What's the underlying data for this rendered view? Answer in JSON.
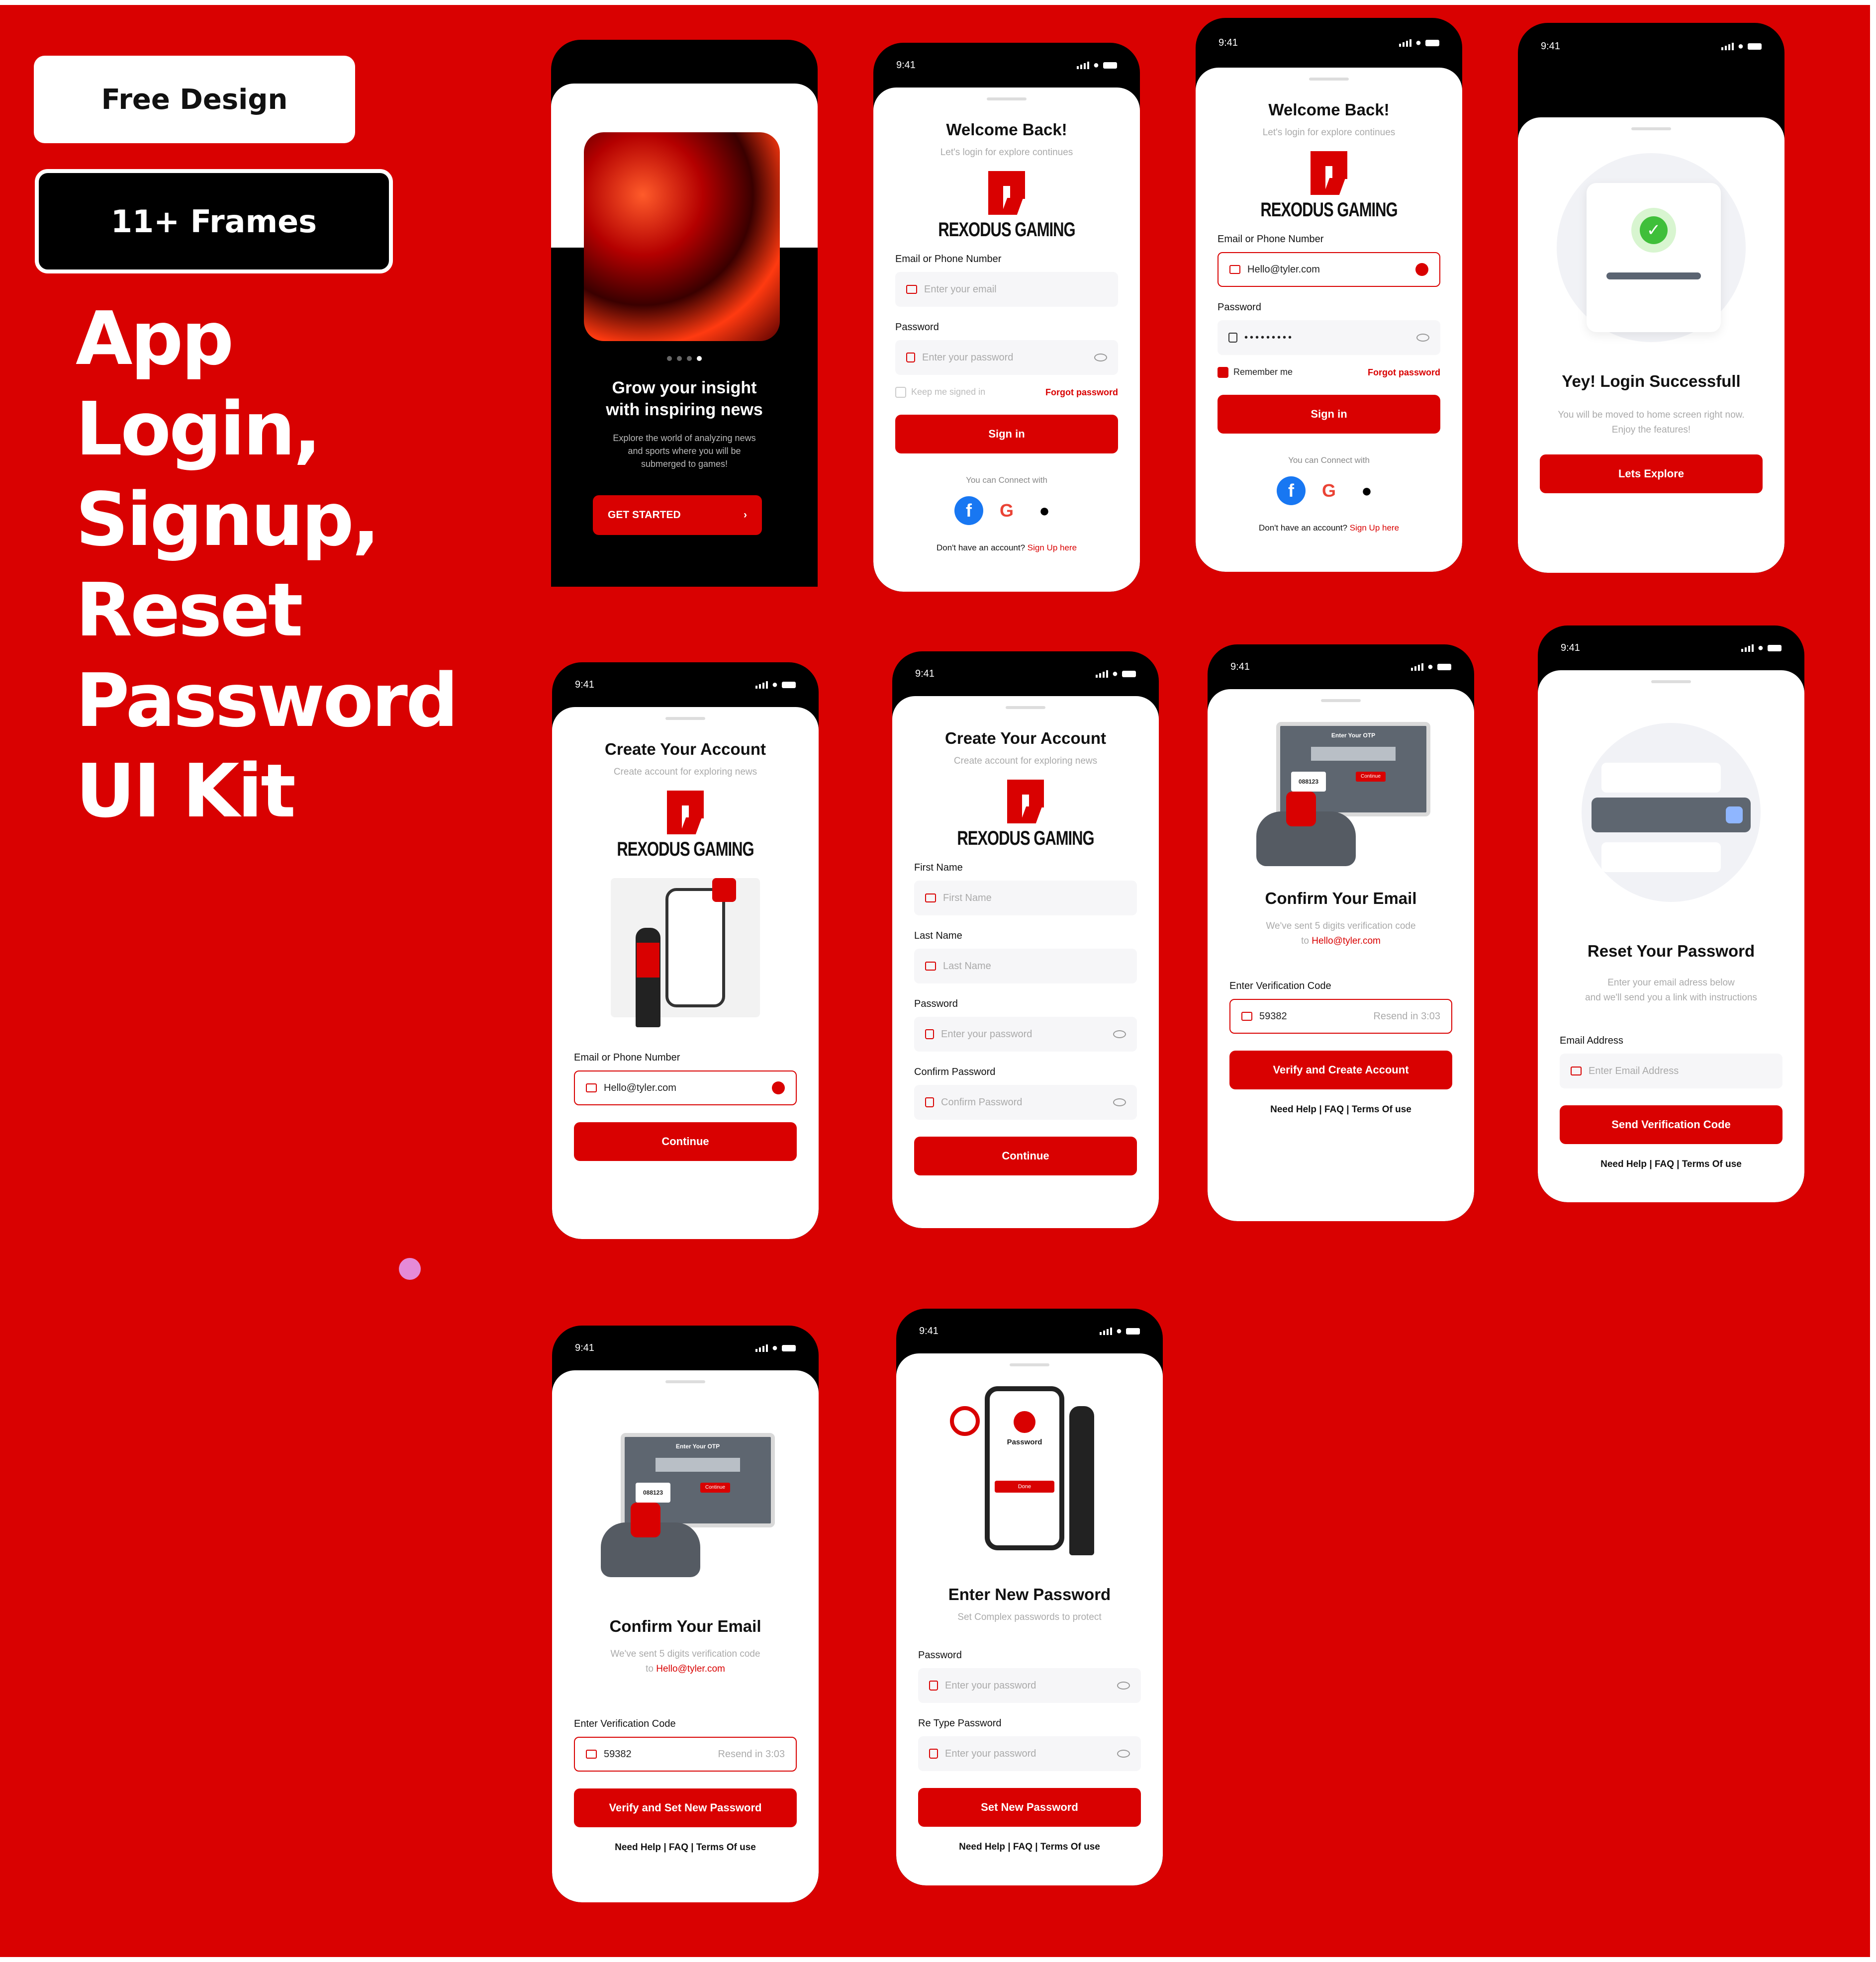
{
  "badges": {
    "free": "Free Design",
    "frames": "11+ Frames"
  },
  "hero": {
    "lines": [
      "App",
      "Login,",
      "Signup,",
      "Reset",
      "Password",
      "UI Kit"
    ]
  },
  "status": {
    "time": "9:41"
  },
  "brand": {
    "name": "REXODUS GAMING"
  },
  "colors": {
    "accent": "#d90101",
    "dark": "#000000",
    "pink": "#e58ad7"
  },
  "onboarding": {
    "title_line1": "Grow your insight",
    "title_line2": "with inspiring news",
    "desc_line1": "Explore the world of analyzing news",
    "desc_line2": "and sports where you will be",
    "desc_line3": "submerged to games!",
    "cta": "GET STARTED"
  },
  "login": {
    "title": "Welcome Back!",
    "subtitle": "Let's login for explore continues",
    "email_label": "Email or Phone Number",
    "email_placeholder": "Enter your email",
    "password_label": "Password",
    "password_placeholder": "Enter your password",
    "keep": "Keep me signed in",
    "forgot": "Forgot password",
    "signin": "Sign in",
    "connect": "You can Connect with",
    "no_account": "Don't have an account?",
    "signup_link": "Sign Up here"
  },
  "login_filled": {
    "email_value": "Hello@tyler.com",
    "password_value": "•••••••••",
    "remember": "Remember me"
  },
  "success": {
    "title": "Yey! Login Successfull",
    "line1": "You will be moved to home screen right now.",
    "line2": "Enjoy the features!",
    "button": "Lets Explore"
  },
  "create": {
    "title": "Create Your Account",
    "subtitle": "Create account for exploring news",
    "email_label": "Email or Phone Number",
    "email_value": "Hello@tyler.com",
    "continue": "Continue",
    "first_label": "First Name",
    "first_placeholder": "First Name",
    "last_label": "Last Name",
    "last_placeholder": "Last Name",
    "password_label": "Password",
    "password_placeholder": "Enter your password",
    "confirm_label": "Confirm Password",
    "confirm_placeholder": "Confirm Password"
  },
  "confirm": {
    "title": "Confirm Your Email",
    "line1": "We've sent 5 digits verification code",
    "to": "to",
    "email": "Hello@tyler.com",
    "code_label": "Enter Verification Code",
    "code_value": "59382",
    "resend": "Resend in 3:03",
    "button": "Verify and Create Account",
    "button_reset": "Verify and Set New Password",
    "otp_screen": "Enter Your OTP",
    "otp_code": "088123",
    "otp_continue": "Continue"
  },
  "reset": {
    "title": "Reset Your Password",
    "line1": "Enter your email adress below",
    "line2": "and we'll send you a link with instructions",
    "email_label": "Email Address",
    "email_placeholder": "Enter Email Address",
    "button": "Send Verification Code"
  },
  "newpass": {
    "title": "Enter New Password",
    "subtitle": "Set Complex passwords to protect",
    "password_label": "Password",
    "password_placeholder": "Enter your password",
    "retype_label": "Re Type Password",
    "illus_title": "Password",
    "illus_done": "Done",
    "button": "Set New Password"
  },
  "footer": {
    "help": "Need Help | FAQ | Terms Of use"
  }
}
